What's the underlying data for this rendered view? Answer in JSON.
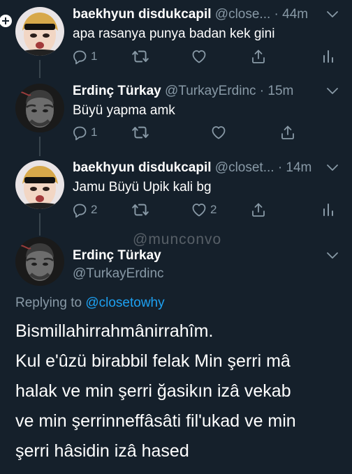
{
  "watermark": "@munconvo",
  "tweets": [
    {
      "name": "baekhyun disdukcapil",
      "handle_time": "@close... · 44m",
      "text": "apa rasanya punya badan kek gini",
      "reply_count": "1",
      "like_count": ""
    },
    {
      "name": "Erdinç Türkay",
      "handle_time": "@TurkayErdinc · 15m",
      "text": "Büyü yapma amk",
      "reply_count": "1",
      "like_count": ""
    },
    {
      "name": "baekhyun disdukcapil",
      "handle_time": "@closet... · 14m",
      "text": "Jamu Büyü Upik kali bg",
      "reply_count": "2",
      "like_count": "2"
    }
  ],
  "main_tweet": {
    "name": "Erdinç Türkay",
    "handle": "@TurkayErdinc",
    "replying_prefix": "Replying to",
    "replying_to": "@closetowhy",
    "lines": [
      "Bismillahirrahmânirrahîm.",
      "Kul e'ûzü birabbil felak Min şerri mâ",
      "halak ve min şerri ğasikın izâ vekab",
      "ve min şerrinneffâsâti fil'ukad ve min",
      "şerri hâsidin izâ hased"
    ]
  },
  "colors": {
    "background": "#15202b",
    "secondary_text": "#8899a6",
    "link": "#1da1f2",
    "divider": "#38444d"
  },
  "icons": [
    "reply-icon",
    "retweet-icon",
    "like-icon",
    "share-icon",
    "analytics-icon",
    "chevron-down-icon"
  ]
}
